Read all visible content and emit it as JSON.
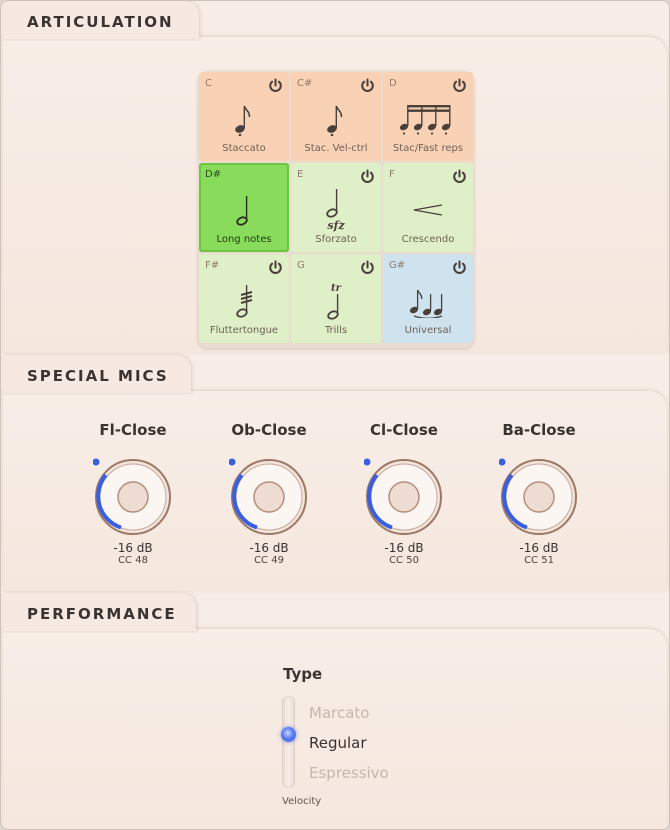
{
  "sections": {
    "articulation": "ARTICULATION",
    "special_mics": "SPECIAL MICS",
    "performance": "PERFORMANCE"
  },
  "articulations": [
    {
      "key": "C",
      "label": "Staccato",
      "color": "orange",
      "icon": "eighth-note-icon"
    },
    {
      "key": "C#",
      "label": "Stac. Vel-ctrl",
      "color": "orange",
      "icon": "eighth-note-icon"
    },
    {
      "key": "D",
      "label": "Stac/Fast reps",
      "color": "orange",
      "icon": "sixteenth-run-icon"
    },
    {
      "key": "D#",
      "label": "Long notes",
      "color": "green",
      "icon": "half-note-icon",
      "active": true
    },
    {
      "key": "E",
      "label": "Sforzato",
      "color": "green",
      "icon": "sfz-note-icon"
    },
    {
      "key": "F",
      "label": "Crescendo",
      "color": "green",
      "icon": "crescendo-icon"
    },
    {
      "key": "F#",
      "label": "Fluttertongue",
      "color": "green",
      "icon": "tremolo-note-icon"
    },
    {
      "key": "G",
      "label": "Trills",
      "color": "green",
      "icon": "trill-note-icon"
    },
    {
      "key": "G#",
      "label": "Universal",
      "color": "blue",
      "icon": "note-group-icon"
    }
  ],
  "mics": [
    {
      "name": "Fl-Close",
      "level": "-16 dB",
      "cc": "CC 48"
    },
    {
      "name": "Ob-Close",
      "level": "-16 dB",
      "cc": "CC 49"
    },
    {
      "name": "Cl-Close",
      "level": "-16 dB",
      "cc": "CC 50"
    },
    {
      "name": "Ba-Close",
      "level": "-16 dB",
      "cc": "CC 51"
    }
  ],
  "performance": {
    "type_label": "Type",
    "options": [
      "Marcato",
      "Regular",
      "Espressivo"
    ],
    "selected": "Regular",
    "velocity_label": "Velocity"
  },
  "colors": {
    "accent": "#3a5ee0",
    "active_green": "#89db5c",
    "orange": "#f9d2b6",
    "green": "#dff0c9",
    "blue": "#cfe3ee"
  }
}
